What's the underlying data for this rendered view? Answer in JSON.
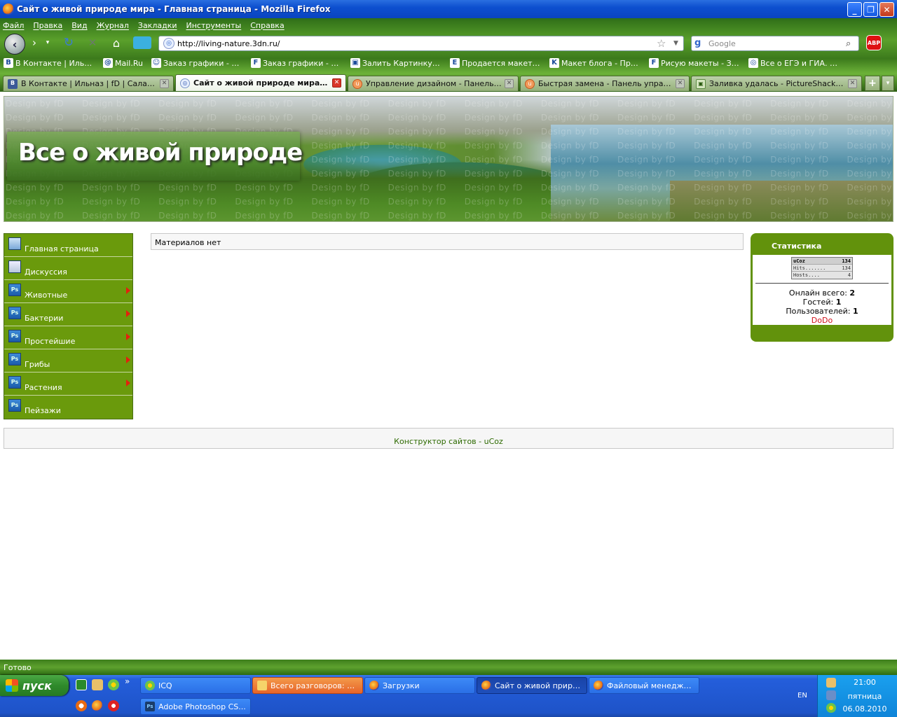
{
  "window": {
    "title": "Сайт о живой природе мира - Главная страница - Mozilla Firefox",
    "buttons": [
      "_",
      "❐",
      "✕"
    ]
  },
  "menubar": [
    "Файл",
    "Правка",
    "Вид",
    "Журнал",
    "Закладки",
    "Инструменты",
    "Справка"
  ],
  "navbar": {
    "url": "http://living-nature.3dn.ru/",
    "search_placeholder": "Google",
    "abp_label": "ABP"
  },
  "bookmarks": [
    {
      "icon": "B",
      "label": "В Контакте | Ильназ ..."
    },
    {
      "icon": "@",
      "label": "Mail.Ru"
    },
    {
      "icon": "☺",
      "label": "Заказ графики - Инф..."
    },
    {
      "icon": "F",
      "label": "Заказ графики - Веб-..."
    },
    {
      "icon": "▣",
      "label": "Залить Картинку - З..."
    },
    {
      "icon": "E",
      "label": "Продается макет - П..."
    },
    {
      "icon": "K",
      "label": "Макет блога - Прода..."
    },
    {
      "icon": "F",
      "label": "Рисую макеты - Зака..."
    },
    {
      "icon": "◎",
      "label": "Все о ЕГЭ и ГИА. Тра..."
    }
  ],
  "tabs": [
    {
      "icon": "B",
      "label": "В Контакте | Ильназ | fD | Салахов",
      "active": false
    },
    {
      "icon": "◎",
      "label": "Сайт о живой природе мира - Г...",
      "active": true
    },
    {
      "icon": "u",
      "label": "Управление дизайном - Панель упр...",
      "active": false
    },
    {
      "icon": "u",
      "label": "Быстрая замена - Панель управлен...",
      "active": false
    },
    {
      "icon": "▣",
      "label": "Заливка удалась - PictureShack® Хо...",
      "active": false
    }
  ],
  "tab_add_label": "+",
  "header": {
    "title": "Все о живой природе",
    "watermark": "Design by fD"
  },
  "left_menu": [
    {
      "label": "Главная страница",
      "icon": "home",
      "arrow": false
    },
    {
      "label": "Дискуссия",
      "icon": "disc",
      "arrow": false
    },
    {
      "label": "Животные",
      "icon": "ps",
      "arrow": true
    },
    {
      "label": "Бактерии",
      "icon": "ps",
      "arrow": true
    },
    {
      "label": "Простейшие",
      "icon": "ps",
      "arrow": true
    },
    {
      "label": "Грибы",
      "icon": "ps",
      "arrow": true
    },
    {
      "label": "Растения",
      "icon": "ps",
      "arrow": true
    },
    {
      "label": "Пейзажи",
      "icon": "ps",
      "arrow": false
    }
  ],
  "main": {
    "message": "Материалов нет"
  },
  "stats": {
    "title": "Статистика",
    "counter": {
      "brand": "uCoz",
      "brand_value": "134",
      "hits_label": "Hits.......",
      "hits_value": "134",
      "hosts_label": "Hosts....",
      "hosts_value": "4"
    },
    "online_label": "Онлайн всего:",
    "online_value": "2",
    "guests_label": "Гостей:",
    "guests_value": "1",
    "users_label": "Пользователей:",
    "users_value": "1",
    "user_name": "DoDo"
  },
  "footer": {
    "text": "Конструктор сайтов",
    "sep": "-",
    "link": "uCoz"
  },
  "statusbar": {
    "text": "Готово"
  },
  "taskbar": {
    "start_label": "пуск",
    "row1": [
      {
        "label": "ICQ",
        "icon": "icq",
        "state": "normal"
      },
      {
        "label": "Всего разговоров: 3...",
        "icon": "folder",
        "state": "flash"
      },
      {
        "label": "Загрузки",
        "icon": "ff",
        "state": "normal"
      },
      {
        "label": "Сайт о живой приро...",
        "icon": "ff",
        "state": "active"
      },
      {
        "label": "Файловый менедже...",
        "icon": "ff",
        "state": "normal"
      }
    ],
    "row2": [
      {
        "label": "Adobe Photoshop CS...",
        "icon": "ps",
        "state": "normal"
      }
    ],
    "ps_icon_text": "Ps",
    "overflow_label": "»",
    "lang": "EN",
    "time": "21:00",
    "day": "пятница",
    "date": "06.08.2010"
  }
}
